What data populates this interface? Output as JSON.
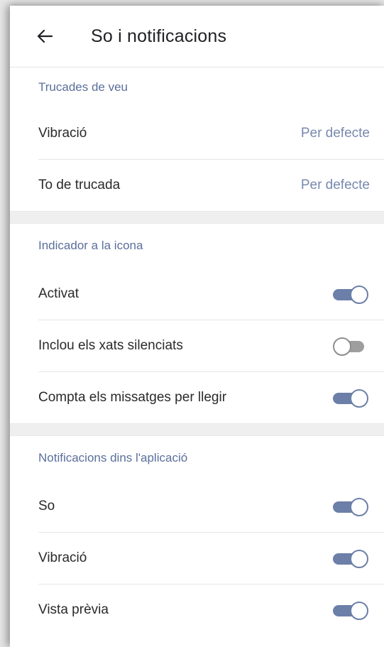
{
  "app_bar": {
    "title": "So i notificacions",
    "back_icon": "arrow-left-icon"
  },
  "sections": [
    {
      "header": "Trucades de veu",
      "rows": [
        {
          "label": "Vibració",
          "value": "Per defecte"
        },
        {
          "label": "To de trucada",
          "value": "Per defecte"
        }
      ]
    },
    {
      "header": "Indicador a la icona",
      "rows": [
        {
          "label": "Activat",
          "toggle": true
        },
        {
          "label": "Inclou els xats silenciats",
          "toggle": false
        },
        {
          "label": "Compta els missatges per llegir",
          "toggle": true
        }
      ]
    },
    {
      "header": "Notificacions dins l'aplicació",
      "rows": [
        {
          "label": "So",
          "toggle": true
        },
        {
          "label": "Vibració",
          "toggle": true
        },
        {
          "label": "Vista prèvia",
          "toggle": true
        }
      ]
    }
  ],
  "colors": {
    "accent": "#6c7fa8",
    "section_header": "#5b6f9b",
    "value_text": "#7889ad"
  }
}
